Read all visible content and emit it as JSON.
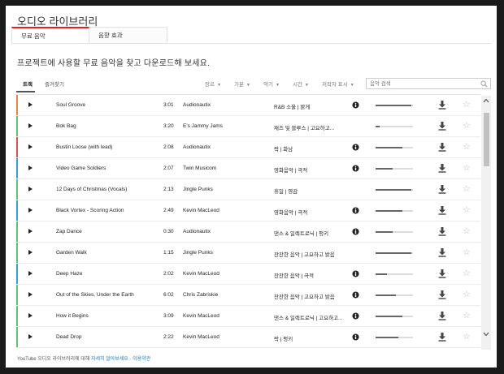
{
  "window": {
    "title": "오디오 라이브러리"
  },
  "tabs": [
    {
      "label": "무료 음악",
      "active": true
    },
    {
      "label": "음향 효과",
      "active": false
    }
  ],
  "intro": "프로젝트에 사용할 무료 음악을 찾고 다운로드해 보세요.",
  "sub_tabs": [
    {
      "label": "트랙",
      "active": true
    },
    {
      "label": "즐겨찾기",
      "active": false
    }
  ],
  "filters": [
    {
      "label": "장르"
    },
    {
      "label": "기분"
    },
    {
      "label": "악기"
    },
    {
      "label": "시간"
    },
    {
      "label": "저작자 표시"
    }
  ],
  "search": {
    "placeholder": "음악 검색",
    "value": "음악 검색"
  },
  "colors": {
    "accent_red": "#e62117",
    "stripe_orange": "#e6883a",
    "stripe_green": "#5cc27a",
    "stripe_red": "#d9534f",
    "stripe_blue": "#35a0d7",
    "link": "#167ac6"
  },
  "tracks": [
    {
      "name": "Soul Groove",
      "duration": "3:01",
      "artist": "Audionautix",
      "genre": "R&B 소울 | 밝게",
      "attribution_required": true,
      "popularity": 0.95,
      "stripe": "#e6883a"
    },
    {
      "name": "Bok Bag",
      "duration": "3:20",
      "artist": "E's Jammy Jams",
      "genre": "재즈 및 블루스 | 고요하고...",
      "attribution_required": false,
      "popularity": 0.1,
      "stripe": "#5cc27a"
    },
    {
      "name": "Bustin Loose (with lead)",
      "duration": "2:08",
      "artist": "Audionautix",
      "genre": "락 | 화남",
      "attribution_required": true,
      "popularity": 0.72,
      "stripe": "#d9534f"
    },
    {
      "name": "Video Game Soldiers",
      "duration": "2:07",
      "artist": "Twin Musicom",
      "genre": "영화음악 | 극적",
      "attribution_required": true,
      "popularity": 0.45,
      "stripe": "#35a0d7"
    },
    {
      "name": "12 Days of Christmas (Vocals)",
      "duration": "2:13",
      "artist": "Jingle Punks",
      "genre": "휴일 | 영감",
      "attribution_required": false,
      "popularity": 0.95,
      "stripe": "#5cc27a"
    },
    {
      "name": "Black Vortex - Scoring Action",
      "duration": "2:49",
      "artist": "Kevin MacLeod",
      "genre": "영화음악 | 극적",
      "attribution_required": true,
      "popularity": 0.72,
      "stripe": "#35a0d7"
    },
    {
      "name": "Zap Dance",
      "duration": "0:30",
      "artist": "Audionautix",
      "genre": "댄스 & 일렉트로닉 | 펑키",
      "attribution_required": true,
      "popularity": 0.45,
      "stripe": "#5cc27a"
    },
    {
      "name": "Garden Walk",
      "duration": "1:15",
      "artist": "Jingle Punks",
      "genre": "잔잔한 음악 | 고요하고 밝음",
      "attribution_required": false,
      "popularity": 0.95,
      "stripe": "#5cc27a"
    },
    {
      "name": "Deep Haze",
      "duration": "2:02",
      "artist": "Kevin MacLeod",
      "genre": "잔잔한 음악 | 극적",
      "attribution_required": true,
      "popularity": 0.3,
      "stripe": "#35a0d7"
    },
    {
      "name": "Out of the Skies, Under the Earth",
      "duration": "6:02",
      "artist": "Chris Zabriskie",
      "genre": "잔잔한 음악 | 고요하고 밝음",
      "attribution_required": true,
      "popularity": 0.55,
      "stripe": "#5cc27a"
    },
    {
      "name": "How it Begins",
      "duration": "3:09",
      "artist": "Kevin MacLeod",
      "genre": "댄스 & 일렉트로닉 | 고요하고...",
      "attribution_required": true,
      "popularity": 0.72,
      "stripe": "#5cc27a"
    },
    {
      "name": "Dead Drop",
      "duration": "2:22",
      "artist": "Kevin MacLeod",
      "genre": "락 | 펑키",
      "attribution_required": true,
      "popularity": 0.6,
      "stripe": "#5cc27a"
    }
  ],
  "footer": {
    "text": "YouTube 오디오 라이브러리에 대해",
    "learn_more": "자세히 알아보세요",
    "terms": "이용약관"
  }
}
